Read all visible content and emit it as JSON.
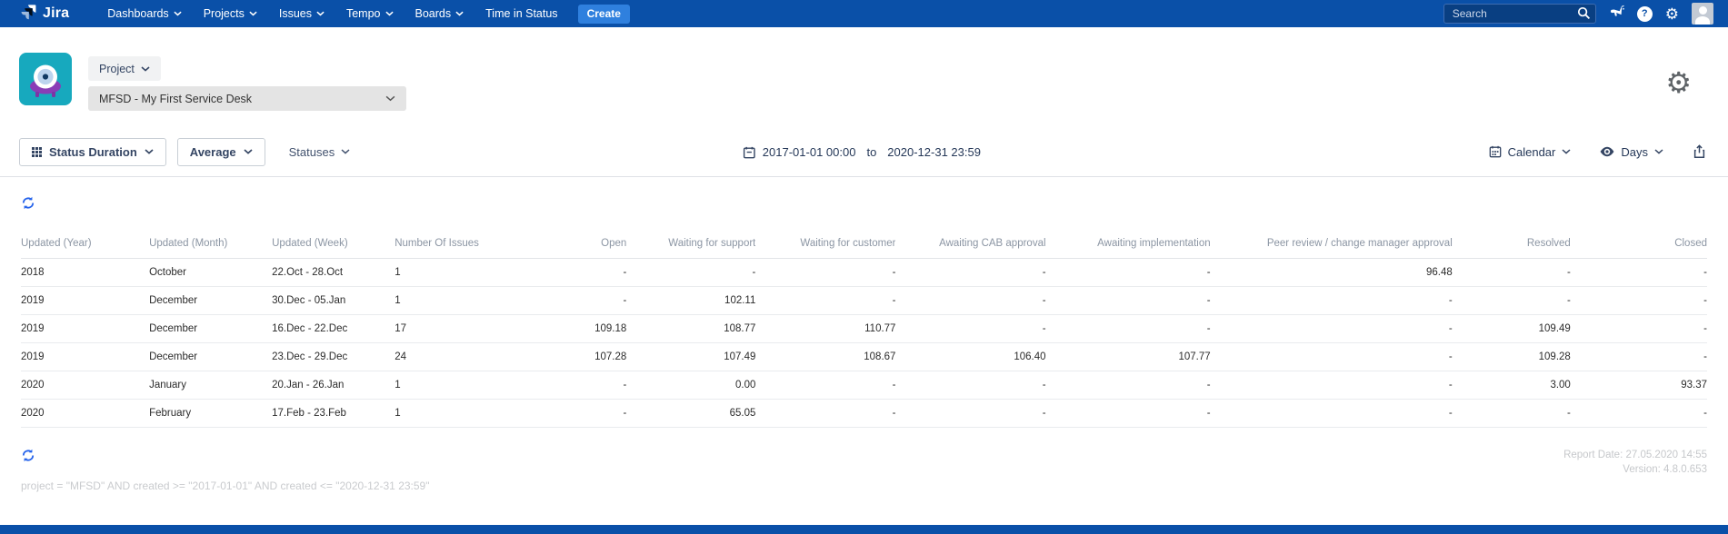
{
  "nav": {
    "brand": "Jira",
    "items": [
      {
        "label": "Dashboards"
      },
      {
        "label": "Projects"
      },
      {
        "label": "Issues"
      },
      {
        "label": "Tempo"
      },
      {
        "label": "Boards"
      },
      {
        "label": "Time in Status"
      }
    ],
    "create_label": "Create",
    "search_placeholder": "Search"
  },
  "project_header": {
    "scope_label": "Project",
    "project_name": "MFSD - My First Service Desk"
  },
  "toolbar": {
    "report_type_label": "Status Duration",
    "aggregation_label": "Average",
    "statuses_label": "Statuses",
    "date_from": "2017-01-01 00:00",
    "date_separator": "to",
    "date_to": "2020-12-31 23:59",
    "calendar_label": "Calendar",
    "unit_label": "Days"
  },
  "table": {
    "columns": [
      {
        "label": "Updated (Year)",
        "align": "left"
      },
      {
        "label": "Updated (Month)",
        "align": "left"
      },
      {
        "label": "Updated (Week)",
        "align": "left"
      },
      {
        "label": "Number Of Issues",
        "align": "left"
      },
      {
        "label": "Open",
        "align": "right"
      },
      {
        "label": "Waiting for support",
        "align": "right"
      },
      {
        "label": "Waiting for customer",
        "align": "right"
      },
      {
        "label": "Awaiting CAB approval",
        "align": "right"
      },
      {
        "label": "Awaiting implementation",
        "align": "right"
      },
      {
        "label": "Peer review / change manager approval",
        "align": "right"
      },
      {
        "label": "Resolved",
        "align": "right"
      },
      {
        "label": "Closed",
        "align": "right"
      }
    ],
    "rows": [
      [
        "2018",
        "October",
        "22.Oct - 28.Oct",
        "1",
        "-",
        "-",
        "-",
        "-",
        "-",
        "96.48",
        "-",
        "-"
      ],
      [
        "2019",
        "December",
        "30.Dec - 05.Jan",
        "1",
        "-",
        "102.11",
        "-",
        "-",
        "-",
        "-",
        "-",
        "-"
      ],
      [
        "2019",
        "December",
        "16.Dec - 22.Dec",
        "17",
        "109.18",
        "108.77",
        "110.77",
        "-",
        "-",
        "-",
        "109.49",
        "-"
      ],
      [
        "2019",
        "December",
        "23.Dec - 29.Dec",
        "24",
        "107.28",
        "107.49",
        "108.67",
        "106.40",
        "107.77",
        "-",
        "109.28",
        "-"
      ],
      [
        "2020",
        "January",
        "20.Jan - 26.Jan",
        "1",
        "-",
        "0.00",
        "-",
        "-",
        "-",
        "-",
        "3.00",
        "93.37"
      ],
      [
        "2020",
        "February",
        "17.Feb - 23.Feb",
        "1",
        "-",
        "65.05",
        "-",
        "-",
        "-",
        "-",
        "-",
        "-"
      ]
    ]
  },
  "footer": {
    "report_date": "Report Date: 27.05.2020 14:55",
    "version": "Version: 4.8.0.653",
    "query": "project = \"MFSD\" AND created >= \"2017-01-01\" AND created <= \"2020-12-31 23:59\""
  },
  "colors": {
    "navbar": "#0a50a8",
    "create_button": "#2f80de",
    "refresh_icon": "#2563eb",
    "project_avatar_teal": "#17a9be",
    "project_avatar_purple": "#8a3db6",
    "divider": "#dfe1e6",
    "table_header_text": "#8b95a3",
    "muted_footer_text": "#c6c8cb"
  }
}
